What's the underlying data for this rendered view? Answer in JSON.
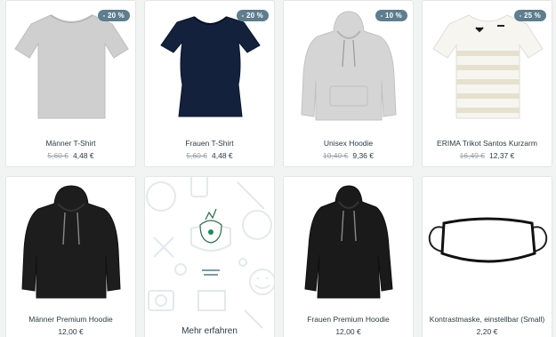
{
  "products": [
    {
      "name": "Männer T-Shirt",
      "badge": "- 20 %",
      "old_price": "5,60 €",
      "price": "4,48 €",
      "icon": "grey-tshirt"
    },
    {
      "name": "Frauen T-Shirt",
      "badge": "- 20 %",
      "old_price": "5,60 €",
      "price": "4,48 €",
      "icon": "navy-women-tshirt"
    },
    {
      "name": "Unisex Hoodie",
      "badge": "- 10 %",
      "old_price": "10,40 €",
      "price": "9,36 €",
      "icon": "grey-hoodie"
    },
    {
      "name": "ERIMA Trikot Santos Kurzarm",
      "badge": "- 25 %",
      "old_price": "16,49 €",
      "price": "12,37 €",
      "icon": "striped-jersey"
    },
    {
      "name": "Männer Premium Hoodie",
      "price": "12,00 €",
      "icon": "black-hoodie"
    },
    {
      "name": "Frauen Premium Hoodie",
      "price": "12,00 €",
      "icon": "black-women-hoodie"
    },
    {
      "name": "Kontrastmaske, einstellbar (Small)",
      "price": "2,20 €",
      "icon": "face-mask"
    }
  ],
  "promo": {
    "label": "Mehr erfahren",
    "icon": "doodle-pattern"
  },
  "colors": {
    "badge": "#5e7d8e",
    "text": "#2b3b45",
    "old_price": "#9aa3a8",
    "page_bg": "#f2f4f4"
  }
}
